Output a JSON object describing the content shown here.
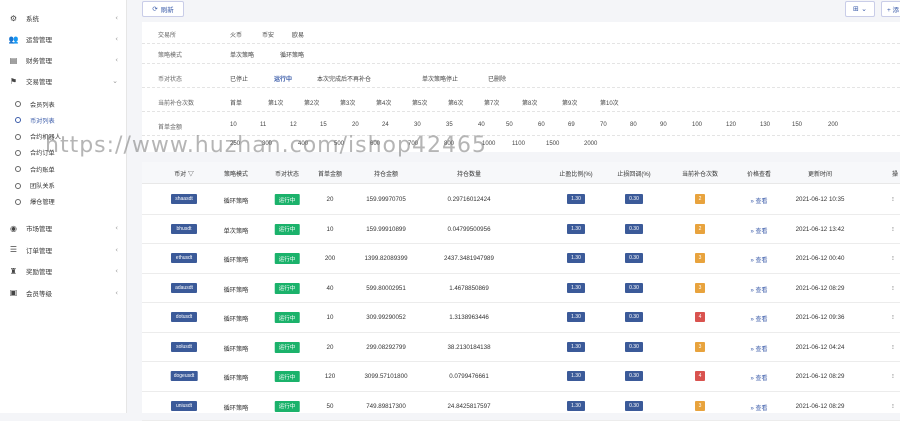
{
  "sidebar": {
    "items": [
      {
        "icon": "gear-icon",
        "glyph": "⚙",
        "label": "系统",
        "arrow": "‹"
      },
      {
        "icon": "users-icon",
        "glyph": "👥",
        "label": "运营管理",
        "arrow": "‹"
      },
      {
        "icon": "finance-icon",
        "glyph": "▤",
        "label": "财务管理",
        "arrow": "‹"
      },
      {
        "icon": "strategy-icon",
        "glyph": "⚑",
        "label": "交易管理",
        "arrow": "⌄"
      }
    ],
    "subitems": [
      {
        "label": "会员列表",
        "active": false
      },
      {
        "label": "币对列表",
        "active": true
      },
      {
        "label": "合约机器人",
        "active": false
      },
      {
        "label": "合约订单",
        "active": false
      },
      {
        "label": "合约账单",
        "active": false
      },
      {
        "label": "团队关系",
        "active": false
      },
      {
        "label": "爆仓管理",
        "active": false
      }
    ],
    "bottom": [
      {
        "icon": "market-icon",
        "glyph": "◉",
        "label": "市场管理",
        "arrow": "‹"
      },
      {
        "icon": "order-icon",
        "glyph": "☰",
        "label": "订单管理",
        "arrow": "‹"
      },
      {
        "icon": "reward-icon",
        "glyph": "♜",
        "label": "奖励管理",
        "arrow": "‹"
      },
      {
        "icon": "level-icon",
        "glyph": "▣",
        "label": "会员等级",
        "arrow": "‹"
      }
    ]
  },
  "toolbar": {
    "refresh": "刷新",
    "add": "+ 添"
  },
  "filters": {
    "row1": {
      "label": "交易所",
      "options": [
        "火币",
        "币安",
        "欧易"
      ]
    },
    "row2": {
      "label": "策略模式",
      "options": [
        "单次策略",
        "循环策略"
      ]
    },
    "row3": {
      "label": "币对状态",
      "options": [
        "已停止",
        "运行中",
        "本次完成后不再补仓",
        "单次策略停止",
        "已删除"
      ]
    },
    "row4": {
      "label": "当前补仓次数",
      "options": [
        "首单",
        "第1次",
        "第2次",
        "第3次",
        "第4次",
        "第5次",
        "第6次",
        "第7次",
        "第8次",
        "第9次",
        "第10次"
      ]
    },
    "row5": {
      "label": "首单金额",
      "options": [
        "10",
        "11",
        "12",
        "15",
        "20",
        "24",
        "30",
        "35",
        "40",
        "50",
        "60",
        "69",
        "70",
        "80",
        "90",
        "100",
        "120",
        "130",
        "150",
        "200"
      ]
    },
    "row6": {
      "options": [
        "250",
        "300",
        "400",
        "500",
        "600",
        "700",
        "800",
        "1000",
        "1100",
        "1500",
        "2000"
      ]
    }
  },
  "table": {
    "headers": [
      "币对 ▽",
      "策略模式",
      "币对状态",
      "首单金额",
      "持仓金额",
      "持仓数量",
      "止盈比例(%)",
      "止损回调(%)",
      "当前补仓次数",
      "价格查看",
      "更新时间",
      "操"
    ],
    "rows": [
      {
        "symbol": "shaasdt",
        "mode": "循环策略",
        "status": "运行中",
        "first": "20",
        "amount": "159.99970705",
        "qty": "0.29716012424",
        "tp": "1.30",
        "sl": "0.30",
        "count": "2",
        "count_color": "#e8a33d",
        "link": "» 查看",
        "time": "2021-06-12 10:35"
      },
      {
        "symbol": "bhusdt",
        "mode": "单次策略",
        "status": "运行中",
        "first": "10",
        "amount": "159.99910899",
        "qty": "0.04799500956",
        "tp": "1.30",
        "sl": "0.30",
        "count": "2",
        "count_color": "#e8a33d",
        "link": "» 查看",
        "time": "2021-06-12 13:42"
      },
      {
        "symbol": "ethusdt",
        "mode": "循环策略",
        "status": "运行中",
        "first": "200",
        "amount": "1399.82089399",
        "qty": "2437.3481947989",
        "tp": "1.30",
        "sl": "0.30",
        "count": "3",
        "count_color": "#e8a33d",
        "link": "» 查看",
        "time": "2021-06-12 00:40"
      },
      {
        "symbol": "adausdt",
        "mode": "循环策略",
        "status": "运行中",
        "first": "40",
        "amount": "599.80002951",
        "qty": "1.4678850869",
        "tp": "1.30",
        "sl": "0.30",
        "count": "3",
        "count_color": "#e8a33d",
        "link": "» 查看",
        "time": "2021-06-12 08:29"
      },
      {
        "symbol": "dotusdt",
        "mode": "循环策略",
        "status": "运行中",
        "first": "10",
        "amount": "309.99290052",
        "qty": "1.3138963446",
        "tp": "1.30",
        "sl": "0.30",
        "count": "4",
        "count_color": "#d9534f",
        "link": "» 查看",
        "time": "2021-06-12 09:36"
      },
      {
        "symbol": "solusdt",
        "mode": "循环策略",
        "status": "运行中",
        "first": "20",
        "amount": "299.08292799",
        "qty": "38.2130184138",
        "tp": "1.30",
        "sl": "0.30",
        "count": "3",
        "count_color": "#e8a33d",
        "link": "» 查看",
        "time": "2021-06-12 04:24"
      },
      {
        "symbol": "dogeusdt",
        "mode": "循环策略",
        "status": "运行中",
        "first": "120",
        "amount": "3099.57101800",
        "qty": "0.0799476661",
        "tp": "1.30",
        "sl": "0.30",
        "count": "4",
        "count_color": "#d9534f",
        "link": "» 查看",
        "time": "2021-06-12 08:29"
      },
      {
        "symbol": "uniusdt",
        "mode": "循环策略",
        "status": "运行中",
        "first": "50",
        "amount": "749.89817300",
        "qty": "24.8425817597",
        "tp": "1.30",
        "sl": "0.30",
        "count": "3",
        "count_color": "#e8a33d",
        "link": "» 查看",
        "time": "2021-06-12 08:29"
      }
    ]
  },
  "watermark": "https://www.huzhan.com/ishop42465"
}
